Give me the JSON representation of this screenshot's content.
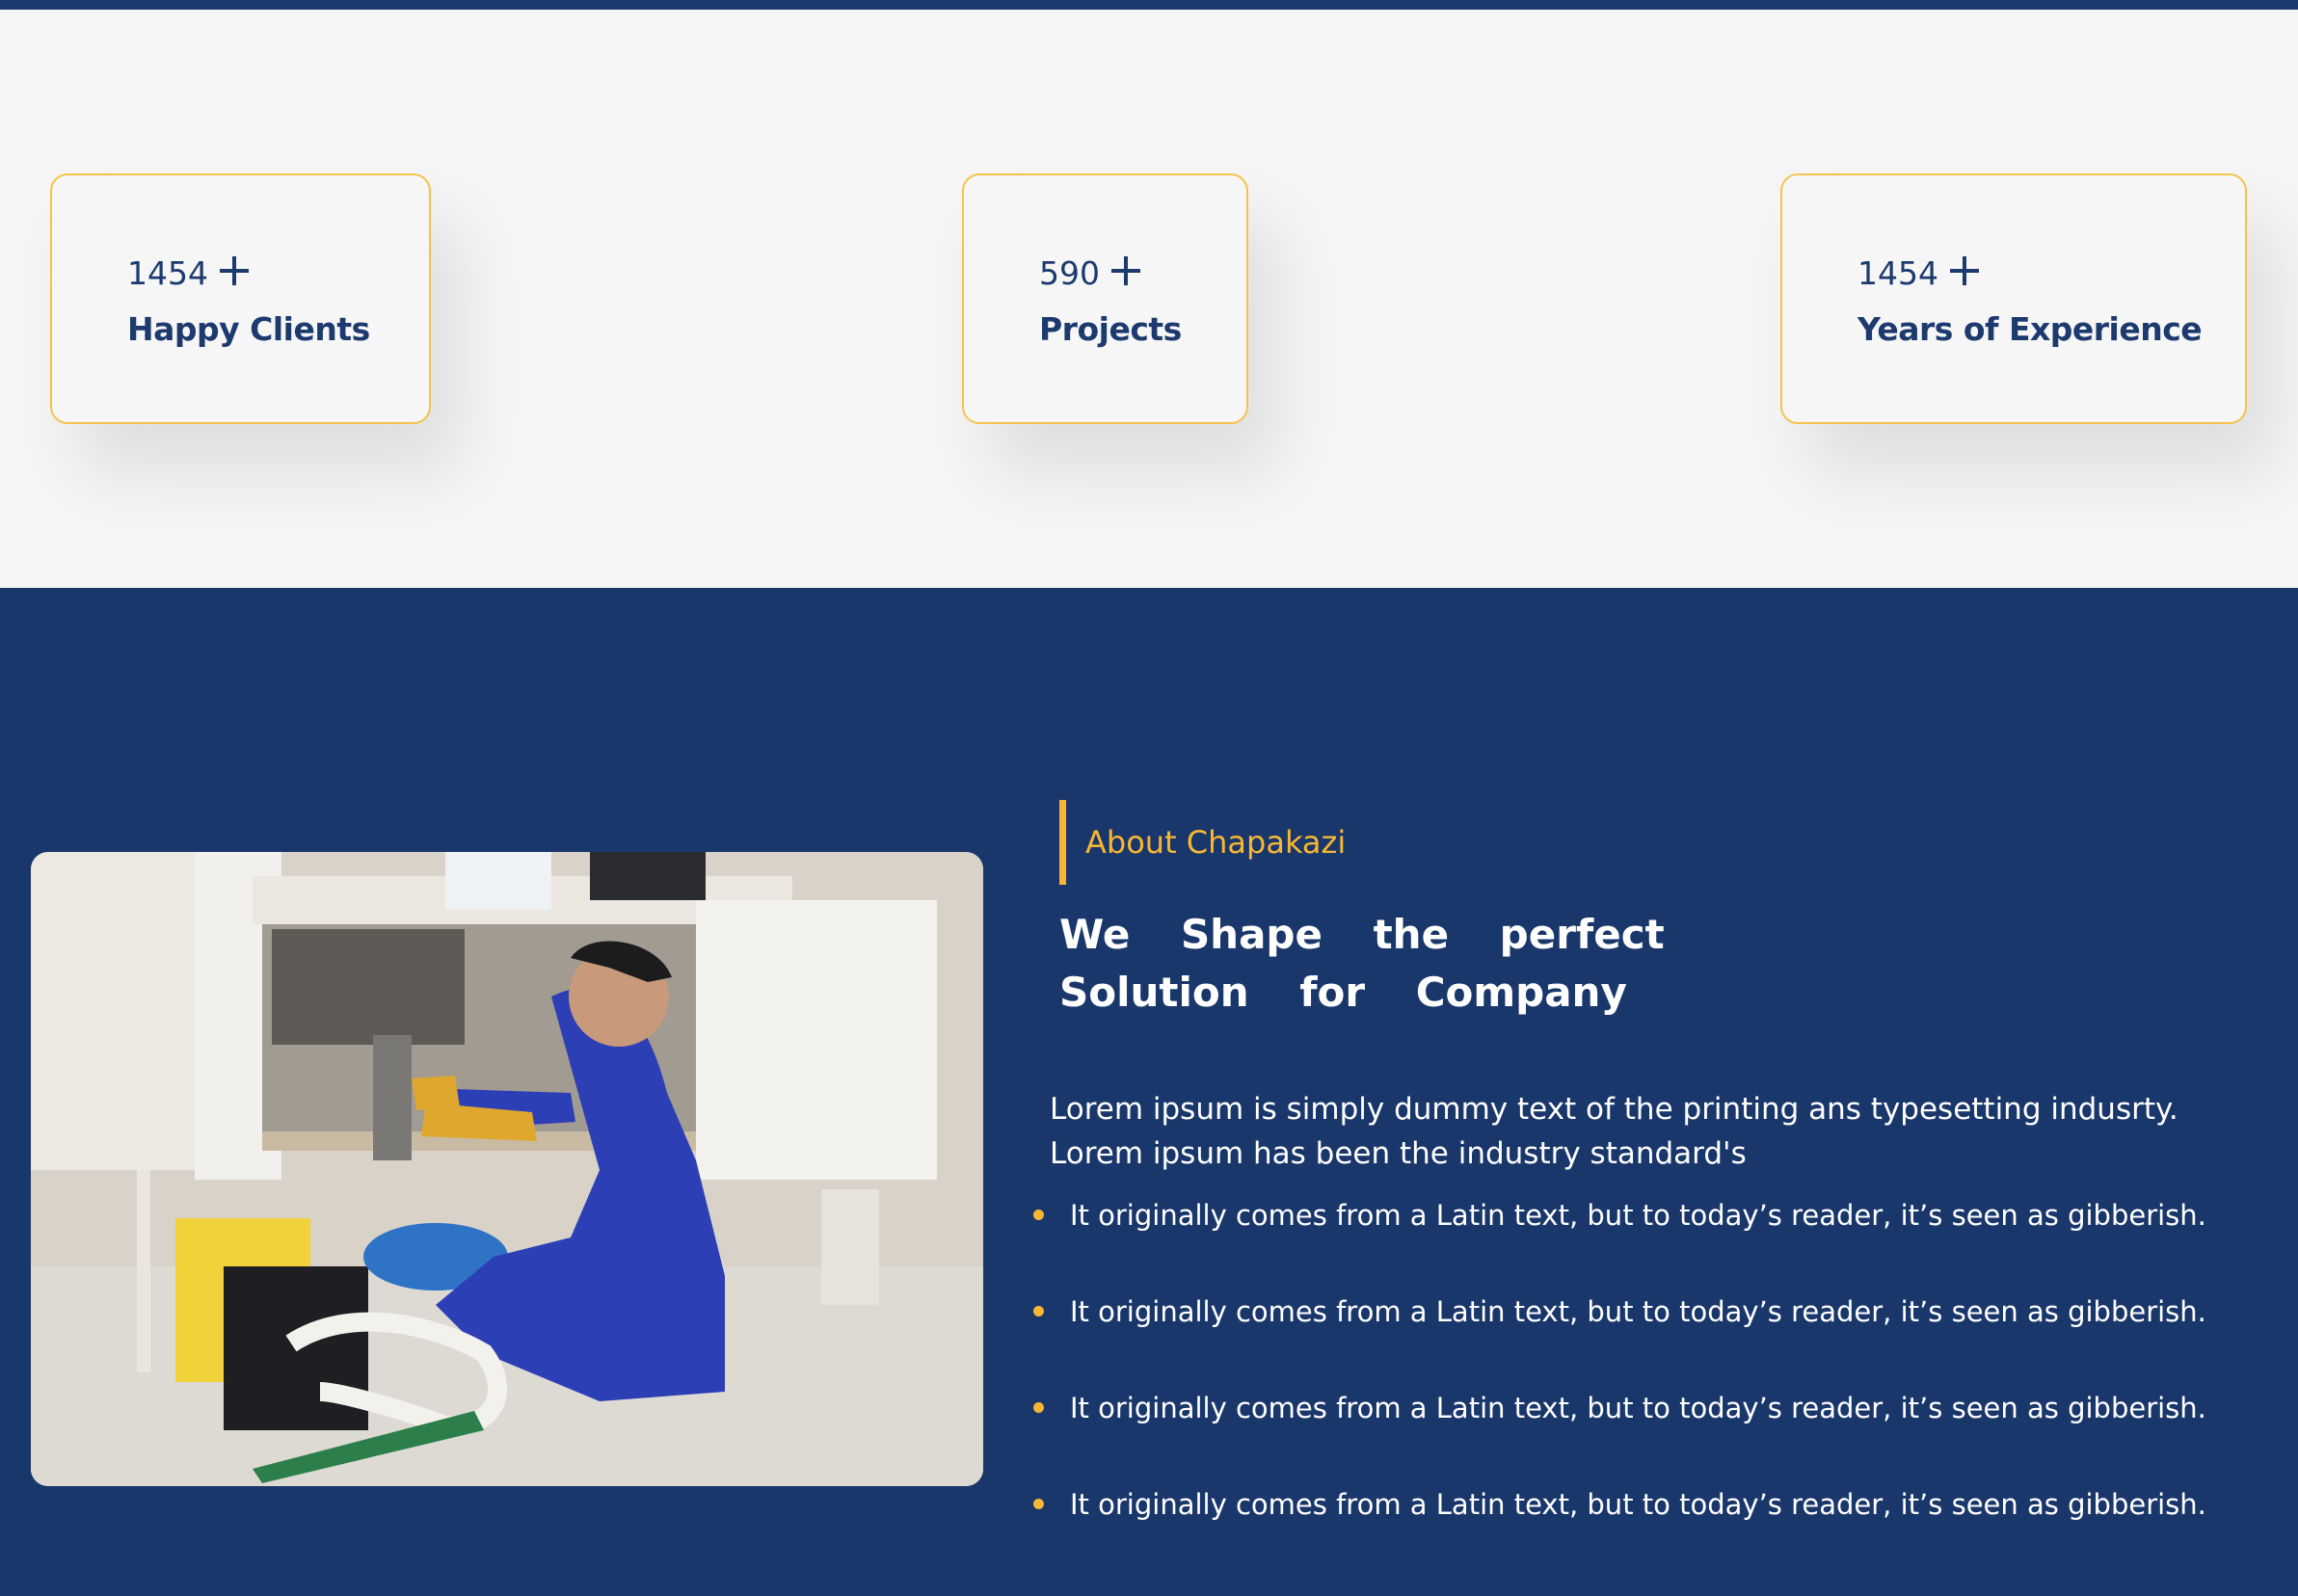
{
  "colors": {
    "navy": "#1a376c",
    "accent": "#f7b733",
    "light_bg": "#f5f5f5"
  },
  "stats": [
    {
      "value": "1454",
      "label": "Happy Clients",
      "icon": "plus-icon"
    },
    {
      "value": "590",
      "label": "Projects",
      "icon": "plus-icon"
    },
    {
      "value": "1454",
      "label": "Years of Experience",
      "icon": "plus-icon"
    }
  ],
  "about": {
    "eyebrow": "About Chapakazi",
    "heading": "We Shape the perfect Solution for Company",
    "intro": "Lorem ipsum is simply dummy text of the printing ans typesetting indusrty. Lorem ipsum has been the industry standard's",
    "bullets": [
      "It originally comes from a Latin text, but to today’s reader, it’s seen as gibberish.",
      "It originally comes from a Latin text, but to today’s reader, it’s seen as gibberish.",
      "It originally comes from a Latin text, but to today’s reader, it’s seen as gibberish.",
      "It originally comes from a Latin text, but to today’s reader, it’s seen as gibberish."
    ],
    "image": "plumber-photo"
  }
}
